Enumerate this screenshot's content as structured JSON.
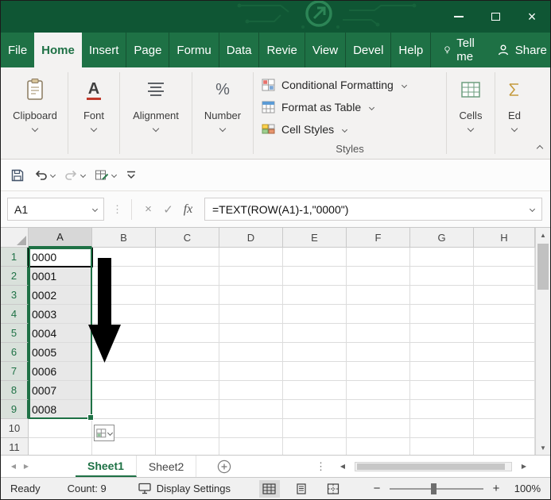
{
  "colors": {
    "titlebar_green": "#0f5634",
    "menubar_green": "#1e7145",
    "accent_green": "#1e7145",
    "active_tab_bg": "#f3f2f1",
    "selection_fill": "#e8e8e8",
    "selected_header_fill": "#d9e1db",
    "annotation_arrow": "#000000"
  },
  "icons": {
    "cancel": "×",
    "enter": "✓",
    "fx": "fx",
    "dots_vertical": "⋮",
    "scroll_up": "▲",
    "scroll_down": "▼",
    "scroll_left": "◀",
    "scroll_right": "▶",
    "zoom_out": "−",
    "zoom_in": "+",
    "font_letter": "A",
    "percent": "%"
  },
  "menu": {
    "items": [
      "File",
      "Home",
      "Insert",
      "Page",
      "Formu",
      "Data",
      "Revie",
      "View",
      "Devel",
      "Help"
    ],
    "active_item": "Home",
    "tell_me_label": "Tell me",
    "share_label": "Share"
  },
  "ribbon": {
    "collapsed_groups": [
      "Clipboard",
      "Font",
      "Alignment",
      "Number",
      "Cells",
      "Ed"
    ],
    "styles_group": {
      "buttons": [
        "Conditional Formatting",
        "Format as Table",
        "Cell Styles"
      ],
      "label": "Styles"
    }
  },
  "formula_bar": {
    "name_box_value": "A1",
    "formula": "=TEXT(ROW(A1)-1,\"0000\")"
  },
  "grid": {
    "columns": [
      "A",
      "B",
      "C",
      "D",
      "E",
      "F",
      "G",
      "H"
    ],
    "rows": [
      "1",
      "2",
      "3",
      "4",
      "5",
      "6",
      "7",
      "8",
      "9",
      "10",
      "11"
    ],
    "cells_a": [
      "0000",
      "0001",
      "0002",
      "0003",
      "0004",
      "0005",
      "0006",
      "0007",
      "0008"
    ],
    "active_cell": "A1",
    "selected_range": "A1:A9"
  },
  "sheet_bar": {
    "tabs": [
      "Sheet1",
      "Sheet2"
    ],
    "active_tab": "Sheet1"
  },
  "status_bar": {
    "mode": "Ready",
    "count": "Count: 9",
    "display_settings": "Display Settings",
    "zoom_level": "100%"
  }
}
